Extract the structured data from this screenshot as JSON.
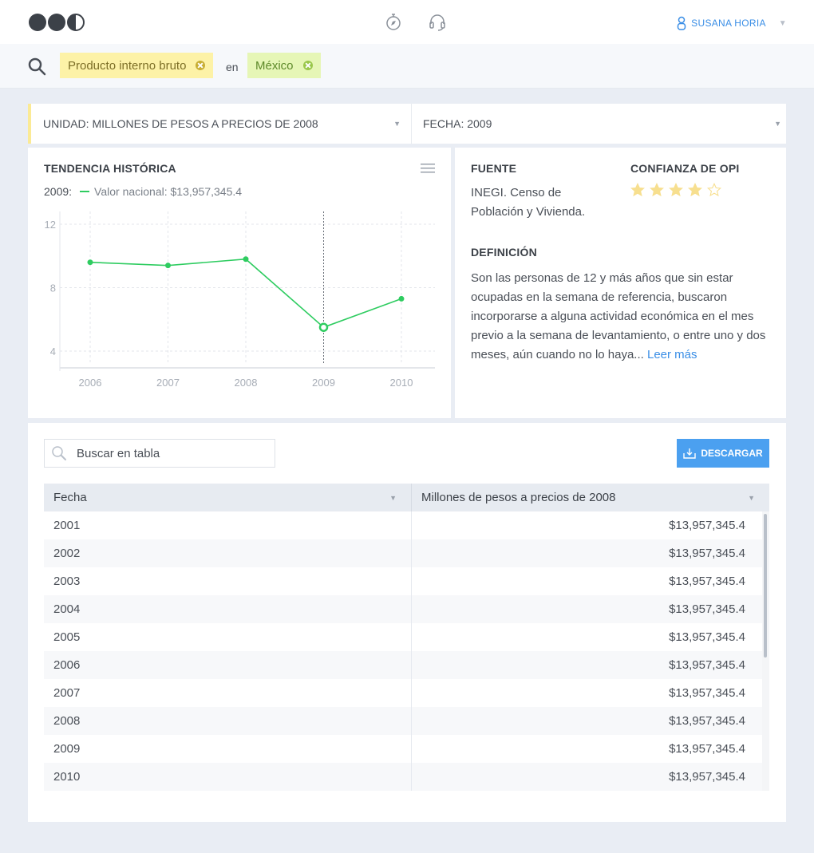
{
  "header": {
    "user_name": "SUSANA HORIA",
    "icons": [
      "logo",
      "compass-icon",
      "headset-icon",
      "user-icon",
      "chevron-down-icon"
    ]
  },
  "search": {
    "chips": [
      {
        "label": "Producto interno bruto",
        "color": "#fdf2a7"
      },
      {
        "label": "México",
        "color": "#e6f6b6"
      }
    ],
    "connector": "en"
  },
  "filters": {
    "unit": "UNIDAD: MILLONES DE PESOS A PRECIOS DE 2008",
    "date": "FECHA: 2009"
  },
  "chart_card": {
    "title": "TENDENCIA HISTÓRICA",
    "legend_year": "2009:",
    "legend_label": "Valor nacional: $13,957,345.4"
  },
  "chart_data": {
    "type": "line",
    "title": "TENDENCIA HISTÓRICA",
    "xlabel": "",
    "ylabel": "",
    "x": [
      "2006",
      "2007",
      "2008",
      "2009",
      "2010"
    ],
    "yticks": [
      "4",
      "8",
      "12"
    ],
    "ylim": [
      3,
      12
    ],
    "series": [
      {
        "name": "Valor nacional",
        "color": "#2ecc60",
        "values": [
          9.6,
          9.4,
          9.8,
          5.5,
          7.3
        ]
      }
    ],
    "highlight_index": 3,
    "grid": true
  },
  "info": {
    "fuente_title": "FUENTE",
    "fuente_text": "INEGI. Censo de Población y Vivienda.",
    "confianza_title": "CONFIANZA DE OPI",
    "rating": 4,
    "rating_max": 5,
    "star_color": "#f7df8f",
    "definicion_title": "DEFINICIÓN",
    "definicion_text": "Son las personas de 12 y más años que sin estar ocupadas en la semana de referencia, buscaron incorporarse a alguna actividad económica en el mes previo a la semana de levantamiento, o entre uno y dos meses, aún cuando no lo haya...",
    "read_more": "Leer más"
  },
  "table": {
    "search_placeholder": "Buscar en tabla",
    "download_label": "DESCARGAR",
    "columns": [
      "Fecha",
      "Millones de pesos a precios de 2008"
    ],
    "rows": [
      [
        "2001",
        "$13,957,345.4"
      ],
      [
        "2002",
        "$13,957,345.4"
      ],
      [
        "2003",
        "$13,957,345.4"
      ],
      [
        "2004",
        "$13,957,345.4"
      ],
      [
        "2005",
        "$13,957,345.4"
      ],
      [
        "2006",
        "$13,957,345.4"
      ],
      [
        "2007",
        "$13,957,345.4"
      ],
      [
        "2008",
        "$13,957,345.4"
      ],
      [
        "2009",
        "$13,957,345.4"
      ],
      [
        "2010",
        "$13,957,345.4"
      ]
    ]
  }
}
